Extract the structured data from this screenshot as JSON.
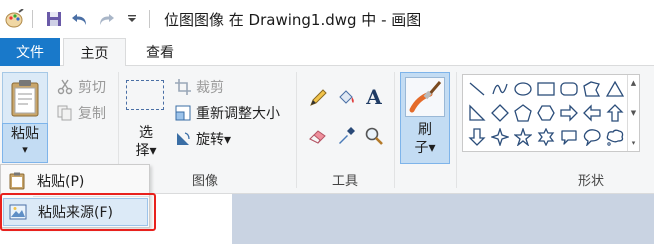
{
  "titlebar": {
    "title": "位图图像 在 Drawing1.dwg 中 - 画图",
    "icons": [
      "paint-app-icon",
      "save-icon",
      "undo-icon",
      "redo-icon",
      "customize-dropdown-icon"
    ]
  },
  "tabs": {
    "file": "文件",
    "home": "主页",
    "view": "查看"
  },
  "clipboard": {
    "paste_top": "粘贴",
    "paste_bottom": "▾",
    "cut": "剪切",
    "copy": "复制"
  },
  "image": {
    "select_top": "选",
    "select_bottom": "择▾",
    "crop": "裁剪",
    "resize": "重新调整大小",
    "rotate": "旋转▾",
    "label": "图像"
  },
  "tools": {
    "label": "工具",
    "icons": [
      "pencil-icon",
      "fill-bucket-icon",
      "text-icon",
      "eraser-icon",
      "color-picker-icon",
      "magnifier-icon"
    ]
  },
  "brushes": {
    "top": "刷",
    "bottom": "子▾"
  },
  "shapes": {
    "label": "形状"
  },
  "menu": {
    "item1": "粘贴(P)",
    "item2": "粘贴来源(F)"
  },
  "colors": {
    "accent": "#1979ca",
    "highlight": "#e8211d",
    "selected_bg": "#c3dcf3",
    "canvas_bg": "#c9d3e2"
  }
}
